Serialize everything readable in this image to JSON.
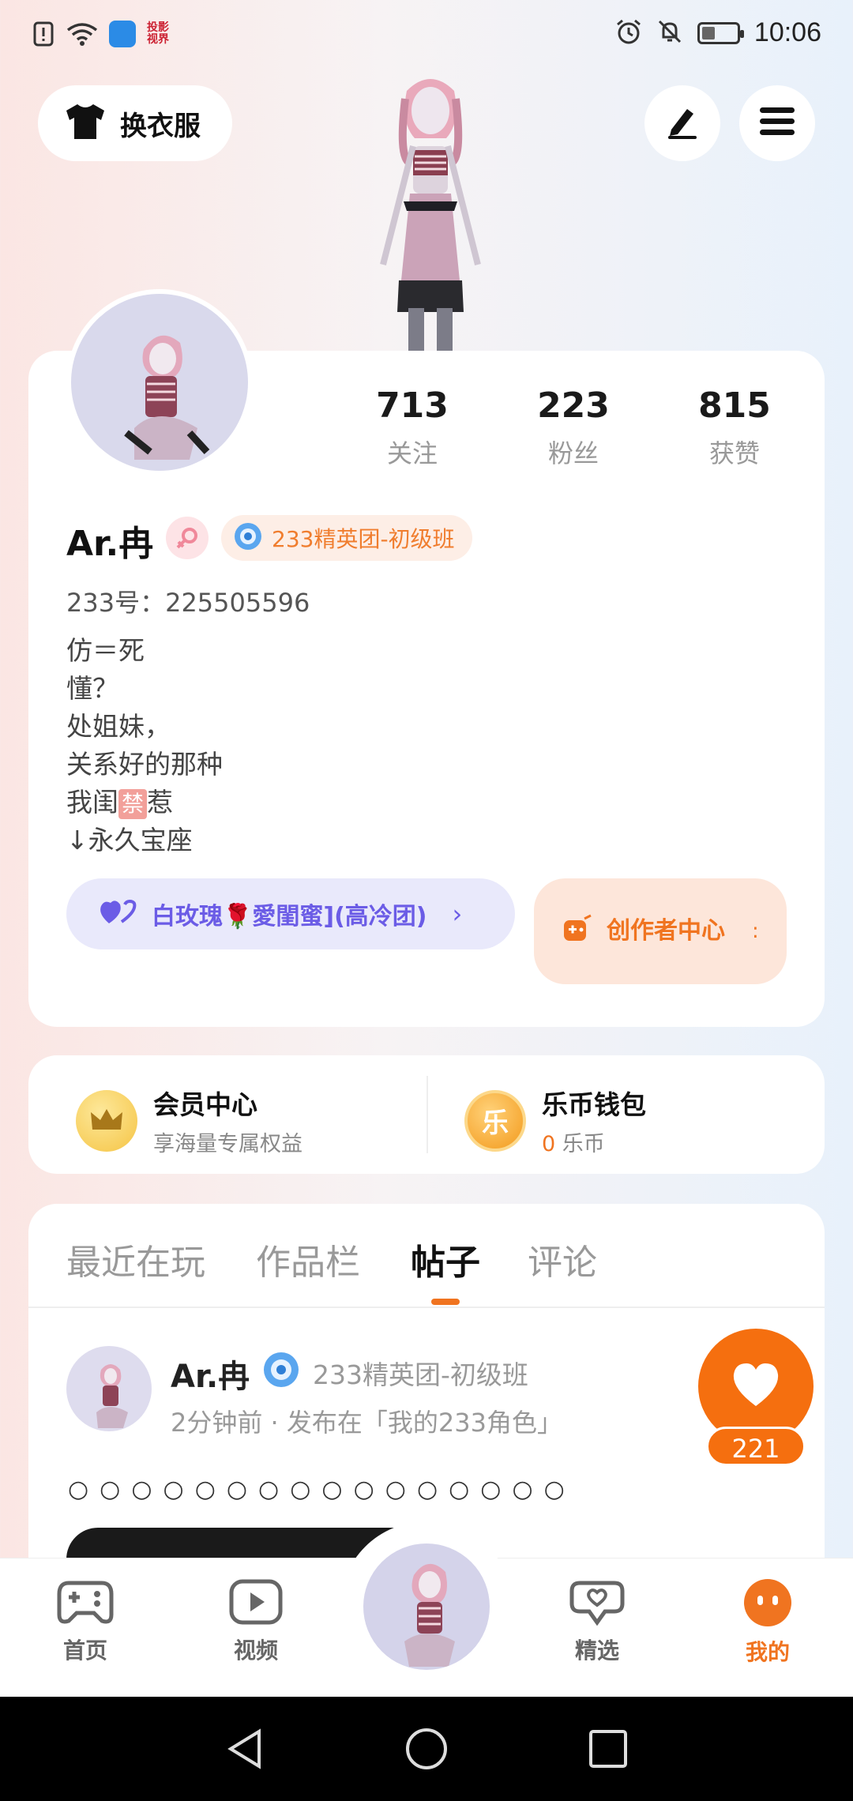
{
  "status_bar": {
    "time": "10:06",
    "tv_logo": "投影\n视界",
    "icons": [
      "alert-icon",
      "wifi-icon",
      "cloud-app-icon",
      "alarm-icon",
      "mute-icon",
      "battery-icon"
    ]
  },
  "top": {
    "outfit_label": "换衣服",
    "edit_icon": "pen-icon",
    "menu_icon": "hamburger-icon"
  },
  "profile": {
    "stats": [
      {
        "num": "713",
        "label": "关注"
      },
      {
        "num": "223",
        "label": "粉丝"
      },
      {
        "num": "815",
        "label": "获赞"
      }
    ],
    "username": "Ar.冉",
    "rank": "233精英团-初级班",
    "user_id": "233号：225505596",
    "bio": [
      "仿＝死",
      "懂？",
      "处姐妹，",
      "关系好的那种",
      "我闺",
      "禁",
      "惹",
      "↓永久宝座"
    ],
    "group_label": "白玫瑰🌹愛閨蜜](高冷团)",
    "creator_label": "创作者中心",
    "creator_trailing": ":"
  },
  "vip": {
    "member_title": "会员中心",
    "member_sub": "享海量专属权益",
    "wallet_title": "乐币钱包",
    "wallet_amount": "0",
    "wallet_unit": "乐币",
    "wallet_coin_char": "乐"
  },
  "tabs": [
    "最近在玩",
    "作品栏",
    "帖子",
    "评论"
  ],
  "active_tab": "帖子",
  "post": {
    "author": "Ar.冉",
    "rank": "233精英团-初级班",
    "meta": "2分钟前 · 发布在「我的233角色」",
    "dots": "○○○○○○○○○○○○○○○○",
    "likes": "221"
  },
  "bottom_nav": [
    {
      "label": "首页",
      "icon": "gamepad-icon"
    },
    {
      "label": "视频",
      "icon": "video-play-icon"
    },
    {
      "label": "精选",
      "icon": "heart-chat-icon"
    },
    {
      "label": "我的",
      "icon": "face-icon"
    }
  ],
  "colors": {
    "accent": "#f07420",
    "like": "#f56f0f",
    "group_text": "#6b5ce6"
  }
}
